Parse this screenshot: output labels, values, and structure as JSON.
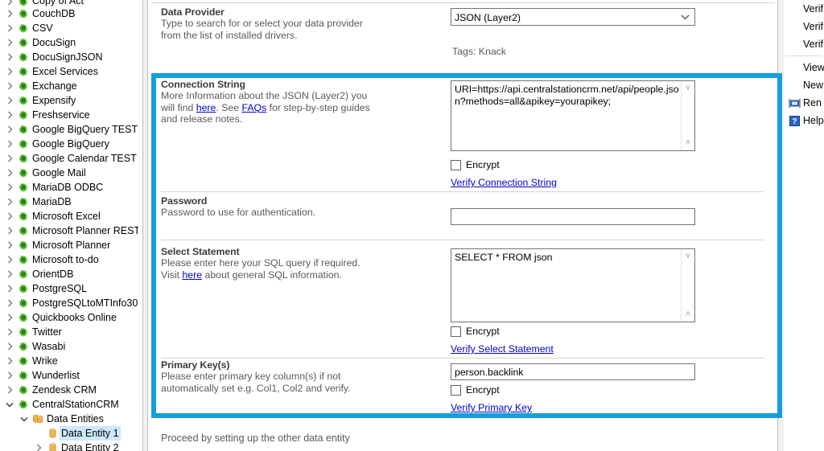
{
  "tree": {
    "items": [
      {
        "label": "Copy of Act",
        "indent": 0,
        "chevron": "right",
        "icon": "plugin-icon",
        "selected": false,
        "clipped_top": true
      },
      {
        "label": "CouchDB",
        "indent": 0,
        "chevron": "right",
        "icon": "plugin-icon",
        "selected": false
      },
      {
        "label": "CSV",
        "indent": 0,
        "chevron": "right",
        "icon": "plugin-icon",
        "selected": false
      },
      {
        "label": "DocuSign",
        "indent": 0,
        "chevron": "right",
        "icon": "plugin-icon",
        "selected": false
      },
      {
        "label": "DocuSignJSON",
        "indent": 0,
        "chevron": "right",
        "icon": "plugin-icon",
        "selected": false
      },
      {
        "label": "Excel Services",
        "indent": 0,
        "chevron": "right",
        "icon": "plugin-icon",
        "selected": false
      },
      {
        "label": "Exchange",
        "indent": 0,
        "chevron": "right",
        "icon": "plugin-icon",
        "selected": false
      },
      {
        "label": "Expensify",
        "indent": 0,
        "chevron": "right",
        "icon": "plugin-icon",
        "selected": false
      },
      {
        "label": "Freshservice",
        "indent": 0,
        "chevron": "right",
        "icon": "plugin-icon",
        "selected": false
      },
      {
        "label": "Google BigQuery TEST",
        "indent": 0,
        "chevron": "right",
        "icon": "plugin-icon",
        "selected": false
      },
      {
        "label": "Google BigQuery",
        "indent": 0,
        "chevron": "right",
        "icon": "plugin-icon",
        "selected": false
      },
      {
        "label": "Google Calendar TEST",
        "indent": 0,
        "chevron": "right",
        "icon": "plugin-icon",
        "selected": false
      },
      {
        "label": "Google Mail",
        "indent": 0,
        "chevron": "right",
        "icon": "plugin-icon",
        "selected": false
      },
      {
        "label": "MariaDB ODBC",
        "indent": 0,
        "chevron": "right",
        "icon": "plugin-icon",
        "selected": false
      },
      {
        "label": "MariaDB",
        "indent": 0,
        "chevron": "right",
        "icon": "plugin-icon",
        "selected": false
      },
      {
        "label": "Microsoft Excel",
        "indent": 0,
        "chevron": "right",
        "icon": "plugin-icon",
        "selected": false
      },
      {
        "label": "Microsoft Planner REST",
        "indent": 0,
        "chevron": "right",
        "icon": "plugin-icon",
        "selected": false
      },
      {
        "label": "Microsoft Planner",
        "indent": 0,
        "chevron": "right",
        "icon": "plugin-icon",
        "selected": false
      },
      {
        "label": "Microsoft to-do",
        "indent": 0,
        "chevron": "right",
        "icon": "plugin-icon",
        "selected": false
      },
      {
        "label": "OrientDB",
        "indent": 0,
        "chevron": "right",
        "icon": "plugin-icon",
        "selected": false
      },
      {
        "label": "PostgreSQL",
        "indent": 0,
        "chevron": "right",
        "icon": "plugin-icon",
        "selected": false
      },
      {
        "label": "PostgreSQLtoMTInfo30",
        "indent": 0,
        "chevron": "right",
        "icon": "plugin-icon",
        "selected": false
      },
      {
        "label": "Quickbooks Online",
        "indent": 0,
        "chevron": "right",
        "icon": "plugin-icon",
        "selected": false
      },
      {
        "label": "Twitter",
        "indent": 0,
        "chevron": "right",
        "icon": "plugin-icon",
        "selected": false
      },
      {
        "label": "Wasabi",
        "indent": 0,
        "chevron": "right",
        "icon": "plugin-icon",
        "selected": false
      },
      {
        "label": "Wrike",
        "indent": 0,
        "chevron": "right",
        "icon": "plugin-icon",
        "selected": false
      },
      {
        "label": "Wunderlist",
        "indent": 0,
        "chevron": "right",
        "icon": "plugin-icon",
        "selected": false
      },
      {
        "label": "Zendesk CRM",
        "indent": 0,
        "chevron": "right",
        "icon": "plugin-icon",
        "selected": false
      },
      {
        "label": "CentralStationCRM",
        "indent": 0,
        "chevron": "down",
        "icon": "plugin-icon",
        "selected": false
      },
      {
        "label": "Data Entities",
        "indent": 1,
        "chevron": "down",
        "icon": "entities-folder-icon",
        "selected": false
      },
      {
        "label": "Data Entity 1",
        "indent": 2,
        "chevron": "none",
        "icon": "entity-icon",
        "selected": true
      },
      {
        "label": "Data Entity 2",
        "indent": 2,
        "chevron": "right",
        "icon": "entity-icon",
        "selected": false
      }
    ]
  },
  "main": {
    "data_provider": {
      "title": "Data Provider",
      "description": "Type to search for or select your data provider from the list of installed drivers.",
      "value": "JSON (Layer2)",
      "tags": "Tags: Knack"
    },
    "connection_string": {
      "title": "Connection String",
      "desc_part1": "More Information about the JSON (Layer2) you will find ",
      "link_here": "here",
      "desc_part2": ". See ",
      "link_faqs": "FAQs",
      "desc_part3": " for step-by-step guides and release notes.",
      "value": "URI=https://api.centralstationcrm.net/api/people.json?methods=all&apikey=yourapikey;",
      "encrypt_label": "Encrypt",
      "encrypt_checked": false,
      "verify_link": "Verify Connection String"
    },
    "password": {
      "title": "Password",
      "description": "Password to use for authentication.",
      "value": ""
    },
    "select_statement": {
      "title": "Select Statement",
      "desc_part1": "Please enter here your SQL query if required. Visit ",
      "link_here": "here",
      "desc_part2": " about general SQL information.",
      "value": "SELECT * FROM json",
      "encrypt_label": "Encrypt",
      "encrypt_checked": false,
      "verify_link": "Verify Select Statement"
    },
    "primary_keys": {
      "title": "Primary Key(s)",
      "description": "Please enter primary key column(s) if not automatically set e.g. Col1, Col2 and verify.",
      "value": "person.backlink",
      "encrypt_label": "Encrypt",
      "encrypt_checked": false,
      "verify_link": "Verify Primary Key"
    },
    "footer_note": "Proceed by setting up the other data entity"
  },
  "right_menu": {
    "items": [
      {
        "label": "Verif",
        "icon": "none"
      },
      {
        "label": "Verif",
        "icon": "none"
      },
      {
        "label": "Verif",
        "icon": "none"
      },
      {
        "label": "View",
        "icon": "none",
        "separator_above": true
      },
      {
        "label": "New",
        "icon": "none"
      },
      {
        "label": "Ren",
        "icon": "rename-icon"
      },
      {
        "label": "Help",
        "icon": "help-icon"
      }
    ]
  },
  "colors": {
    "highlight_blue": "#159fda",
    "selection_blue": "#cce8ff",
    "link_blue": "#0000cc",
    "plugin_green": "#4ab225",
    "folder_orange": "#e8a33d"
  }
}
